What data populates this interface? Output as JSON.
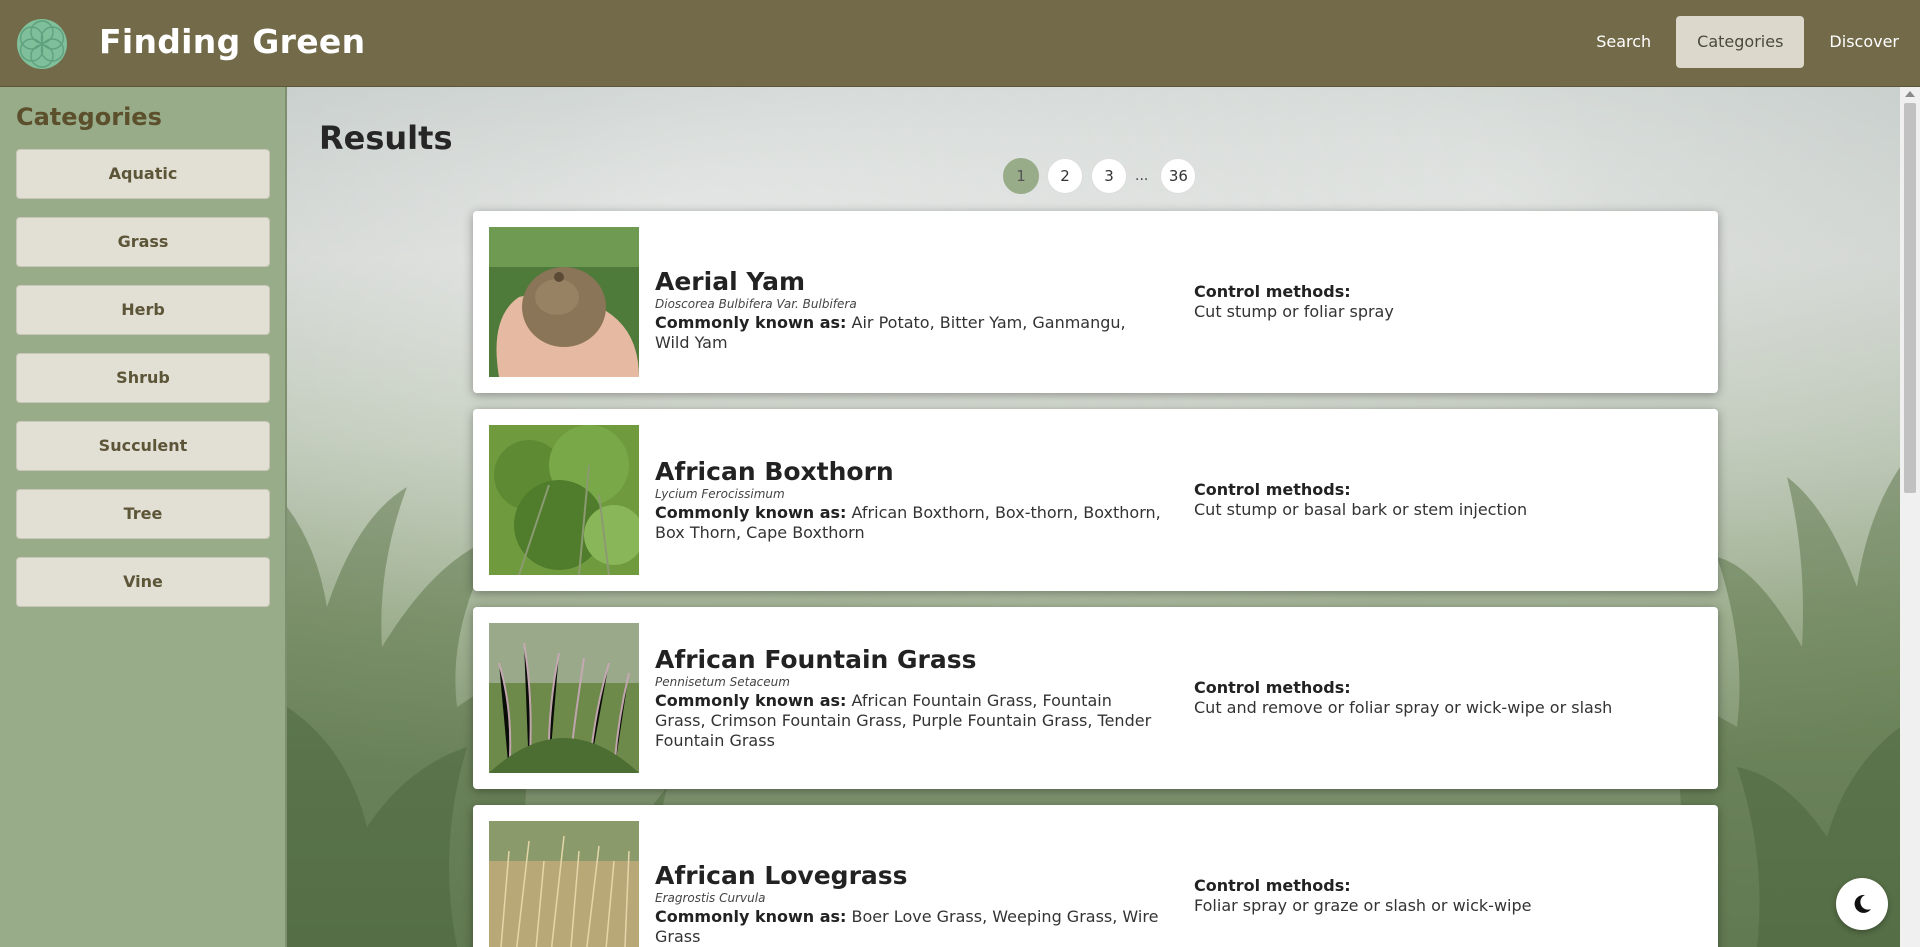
{
  "header": {
    "title": "Finding Green",
    "nav": [
      {
        "label": "Search",
        "active": false
      },
      {
        "label": "Categories",
        "active": true
      },
      {
        "label": "Discover",
        "active": false
      }
    ]
  },
  "sidebar": {
    "title": "Categories",
    "items": [
      "Aquatic",
      "Grass",
      "Herb",
      "Shrub",
      "Succulent",
      "Tree",
      "Vine"
    ]
  },
  "main": {
    "title": "Results",
    "pagination": {
      "pages": [
        "1",
        "2",
        "3"
      ],
      "ellipsis": "...",
      "last": "36",
      "current": "1"
    },
    "results": [
      {
        "name": "Aerial Yam",
        "scientific": "Dioscorea Bulbifera Var. Bulbifera",
        "common_label": "Commonly known as:",
        "common": "Air Potato, Bitter Yam, Ganmangu, Wild Yam",
        "control_label": "Control methods:",
        "control": "Cut stump or foliar spray"
      },
      {
        "name": "African Boxthorn",
        "scientific": "Lycium Ferocissimum",
        "common_label": "Commonly known as:",
        "common": "African Boxthorn, Box-thorn, Boxthorn, Box Thorn, Cape Boxthorn",
        "control_label": "Control methods:",
        "control": "Cut stump or basal bark or stem injection"
      },
      {
        "name": "African Fountain Grass",
        "scientific": "Pennisetum Setaceum",
        "common_label": "Commonly known as:",
        "common": "African Fountain Grass, Fountain Grass, Crimson Fountain Grass, Purple Fountain Grass, Tender Fountain Grass",
        "control_label": "Control methods:",
        "control": "Cut and remove or foliar spray or wick-wipe or slash"
      },
      {
        "name": "African Lovegrass",
        "scientific": "Eragrostis Curvula",
        "common_label": "Commonly known as:",
        "common": "Boer Love Grass, Weeping Grass, Wire Grass",
        "control_label": "Control methods:",
        "control": "Foliar spray or graze or slash or wick-wipe"
      }
    ]
  },
  "colors": {
    "header_bg": "#726a48",
    "sidebar_bg": "#98ac89",
    "button_bg": "#e2e0d5",
    "accent": "#98ac89"
  },
  "icons": {
    "logo": "flower-logo-icon",
    "dark_mode": "moon-icon"
  }
}
